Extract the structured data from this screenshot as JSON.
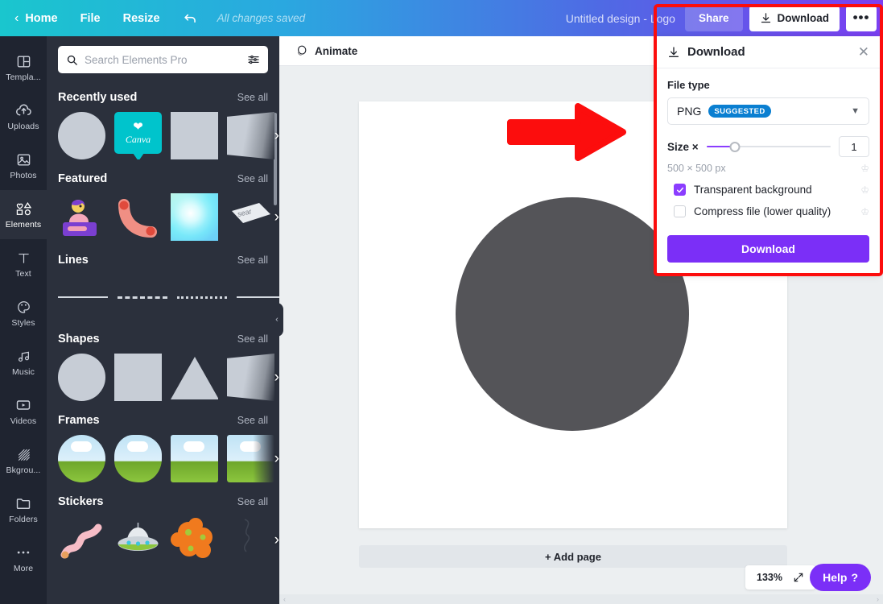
{
  "topbar": {
    "home": "Home",
    "file": "File",
    "resize": "Resize",
    "undo_icon": "undo-icon",
    "save_status": "All changes saved",
    "design_title": "Untitled design - Logo",
    "share": "Share",
    "download": "Download",
    "more": "•••"
  },
  "rail": {
    "items": [
      {
        "label": "Templa...",
        "icon": "templates-icon"
      },
      {
        "label": "Uploads",
        "icon": "upload-cloud-icon"
      },
      {
        "label": "Photos",
        "icon": "photo-icon"
      },
      {
        "label": "Elements",
        "icon": "elements-shapes-icon"
      },
      {
        "label": "Text",
        "icon": "text-t-icon"
      },
      {
        "label": "Styles",
        "icon": "palette-icon"
      },
      {
        "label": "Music",
        "icon": "music-note-icon"
      },
      {
        "label": "Videos",
        "icon": "video-play-icon"
      },
      {
        "label": "Bkgrou...",
        "icon": "background-hatch-icon"
      },
      {
        "label": "Folders",
        "icon": "folder-icon"
      },
      {
        "label": "More",
        "icon": "ellipsis-icon"
      }
    ],
    "active": "Elements"
  },
  "panel": {
    "search_placeholder": "Search Elements Pro",
    "see_all": "See all",
    "sections": [
      {
        "title": "Recently used"
      },
      {
        "title": "Featured"
      },
      {
        "title": "Lines"
      },
      {
        "title": "Shapes"
      },
      {
        "title": "Frames"
      },
      {
        "title": "Stickers"
      }
    ]
  },
  "workspace": {
    "animate": "Animate",
    "add_page": "+ Add page",
    "zoom": "133%",
    "help": "Help",
    "help_mark": "?",
    "canvas_shape_color": "#545458",
    "canvas_bg": "#ffffff"
  },
  "download_panel": {
    "title": "Download",
    "close_icon": "close-icon",
    "file_type_label": "File type",
    "file_type_value": "PNG",
    "file_type_badge": "SUGGESTED",
    "size_label": "Size ×",
    "size_value": "1",
    "dimensions": "500 × 500 px",
    "transparent_label": "Transparent background",
    "transparent_checked": true,
    "compress_label": "Compress file (lower quality)",
    "compress_checked": false,
    "download_button": "Download",
    "accent_color": "#7b2ff7",
    "badge_color": "#0a7fd1",
    "highlight_color": "#fc0d0d"
  },
  "annotation": {
    "arrow": "red-right-arrow",
    "color": "#fc0d0d"
  }
}
